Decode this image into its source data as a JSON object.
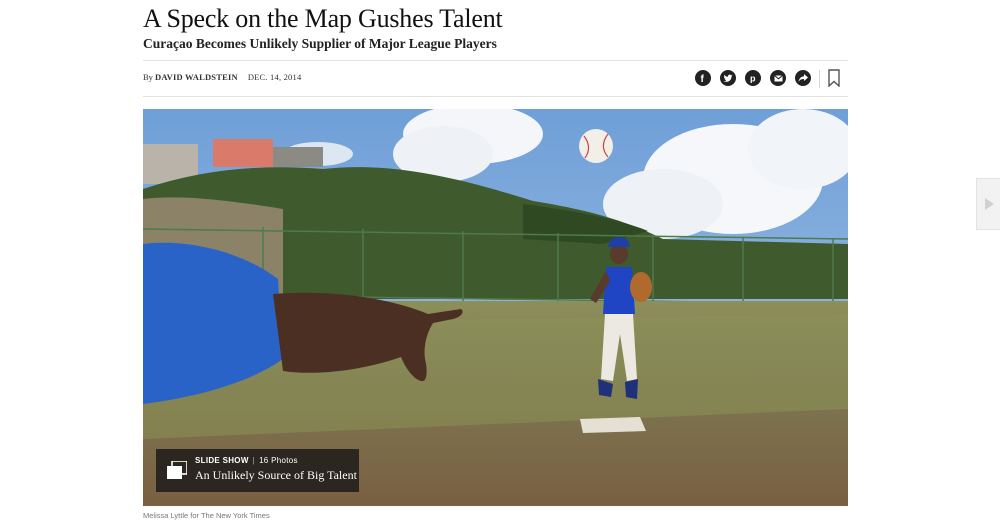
{
  "article": {
    "headline": "A Speck on the Map Gushes Talent",
    "summary": "Curaçao Becomes Unlikely Supplier of Major League Players",
    "byline_prefix": "By",
    "author": "DAVID WALDSTEIN",
    "date": "DEC. 14, 2014"
  },
  "share_tools": [
    {
      "name": "facebook",
      "icon": "facebook-icon"
    },
    {
      "name": "twitter",
      "icon": "twitter-icon"
    },
    {
      "name": "pinterest",
      "icon": "pinterest-icon"
    },
    {
      "name": "email",
      "icon": "email-icon"
    },
    {
      "name": "share",
      "icon": "share-arrow-icon"
    }
  ],
  "bookmark": {
    "icon": "bookmark-icon"
  },
  "lead_media": {
    "image_description_icon": "photo",
    "slideshow": {
      "kicker": "SLIDE SHOW",
      "count": "16 Photos",
      "title": "An Unlikely Source of Big Talent"
    },
    "credit": "Melissa Lyttle for The New York Times"
  },
  "navigation": {
    "next_icon": "next-arrow-icon"
  },
  "colors": {
    "sky": "#7ea6d8",
    "field": "#8a7a58",
    "jersey": "#1a3fb8",
    "promo_bg": "#141414"
  }
}
